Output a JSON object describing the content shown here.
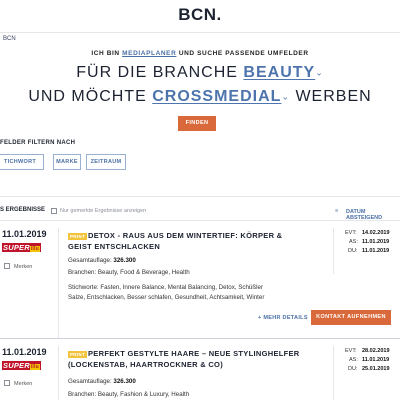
{
  "brand": {
    "logo": "BCN",
    "logo_dot": "."
  },
  "breadcrumb": "BCN",
  "hero": {
    "prefix": "ICH BIN",
    "role_selected": "MEDIAPLANER",
    "suffix": "UND SUCHE PASSENDE UMFELDER",
    "line2_prefix": "FÜR DIE BRANCHE",
    "branch_selected": "BEAUTY",
    "line3_prefix": "UND MÖCHTE",
    "channel_selected": "CROSSMEDIAL",
    "line3_suffix": "WERBEN",
    "find_button": "FINDEN"
  },
  "filters": {
    "label": "FELDER FILTERN NACH",
    "buttons": [
      "TICHWORT",
      "MARKE",
      "ZEITRAUM"
    ]
  },
  "results": {
    "label": "S ERGEBNISSE",
    "checkbox_label": "Nur gemerkte Ergebnisse anzeigen",
    "sort_label": "DATUM ABSTEIGEND"
  },
  "colors": {
    "accent": "#d9693b",
    "link": "#4a6fa5",
    "badge": "#f2c33d",
    "brand_red": "#c0142b"
  },
  "items": [
    {
      "date": "11.01.2019",
      "brand": "SUPER",
      "brand_suffix": "illu",
      "merken": "Merken",
      "badge": "PRINT",
      "title_l1": "DETOX - RAUS AUS DEM WINTERTIEF: KÖRPER &",
      "title_l2": "GEIST ENTSCHLACKEN",
      "circulation_label": "Gesamtauflage:",
      "circulation_value": "326.300",
      "branches": "Branchen: Beauty, Food & Beverage, Health",
      "keywords_l1": "Stichworte: Fasten, Innere Balance, Mental Balancing, Detox, Schüßler",
      "keywords_l2": "Salze, Entschlacken, Besser schlafen, Gesundheit, Achtsamkeit, Winter",
      "evt_label": "EVT:",
      "evt": "14.02.2019",
      "as_label": "AS:",
      "as": "11.01.2019",
      "du_label": "DU:",
      "du": "11.01.2019",
      "more": "+ MEHR DETAILS",
      "contact": "KONTAKT AUFNEHMEN"
    },
    {
      "date": "11.01.2019",
      "brand": "SUPER",
      "brand_suffix": "illu",
      "merken": "Merken",
      "badge": "PRINT",
      "title_l1": "PERFEKT GESTYLTE HAARE – NEUE STYLINGHELFER",
      "title_l2": "(LOCKENSTAB, HAARTROCKNER & CO)",
      "circulation_label": "Gesamtauflage:",
      "circulation_value": "326.300",
      "branches": "Branchen: Beauty, Fashion & Luxury, Health",
      "evt_label": "EVT:",
      "evt": "28.02.2019",
      "as_label": "AS:",
      "as": "11.01.2019",
      "du_label": "DU:",
      "du": "25.01.2019"
    }
  ]
}
